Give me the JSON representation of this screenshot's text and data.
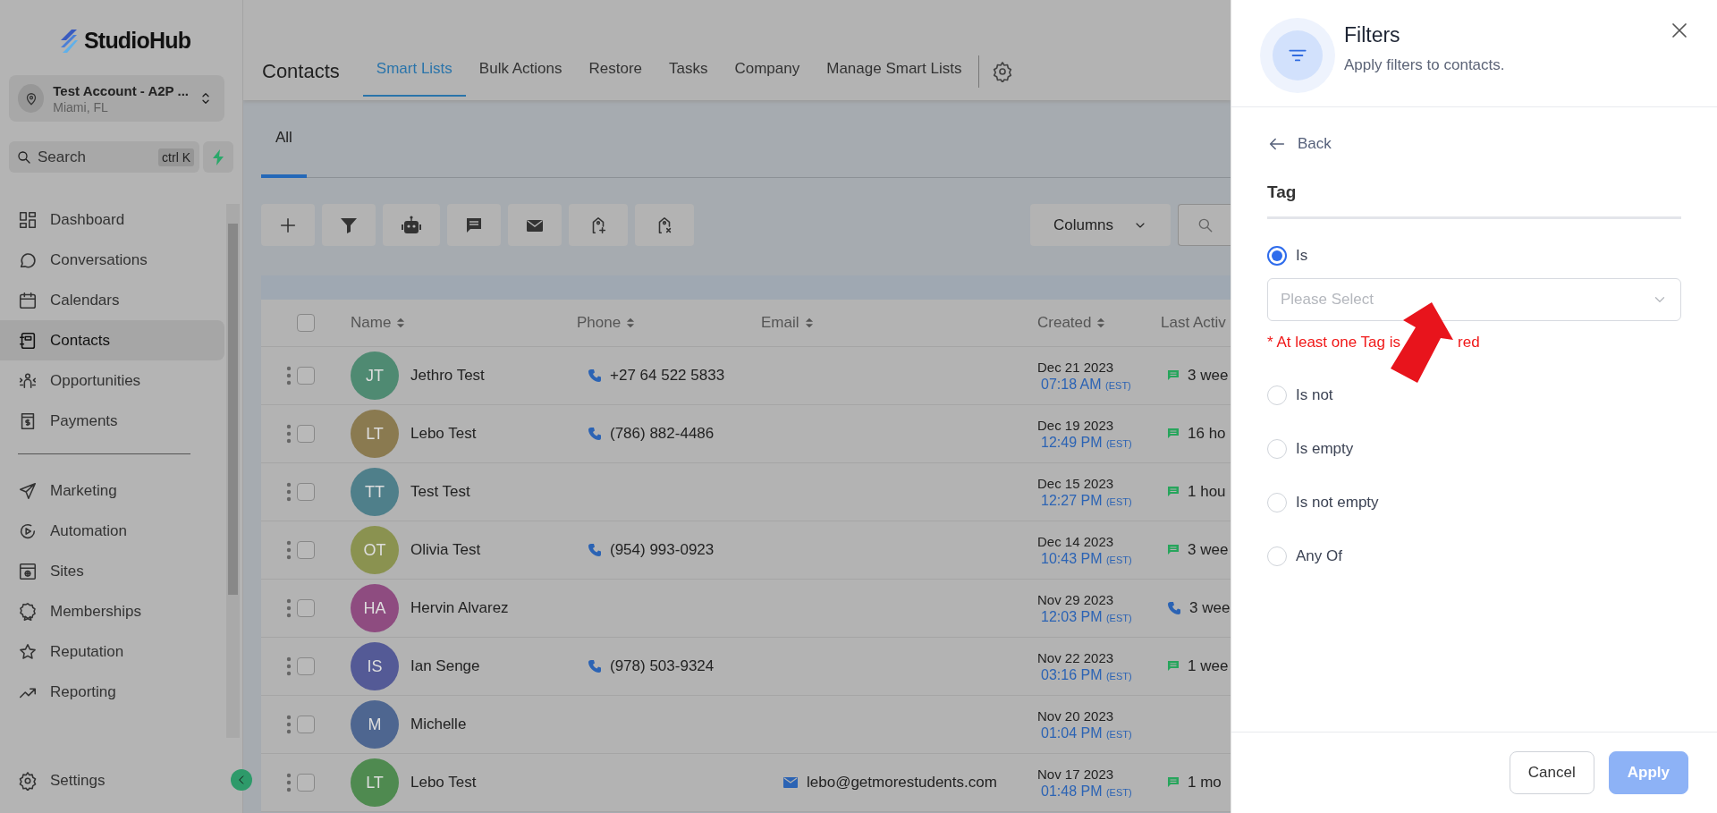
{
  "sidebar": {
    "logo": "StudioHub",
    "account": {
      "name": "Test Account - A2P ...",
      "location": "Miami, FL"
    },
    "search": {
      "placeholder": "Search",
      "shortcut": "ctrl K"
    },
    "main_items": [
      {
        "label": "Dashboard",
        "selected": false
      },
      {
        "label": "Conversations",
        "selected": false
      },
      {
        "label": "Calendars",
        "selected": false
      },
      {
        "label": "Contacts",
        "selected": true
      },
      {
        "label": "Opportunities",
        "selected": false
      },
      {
        "label": "Payments",
        "selected": false
      }
    ],
    "marketing_items": [
      {
        "label": "Marketing",
        "selected": false
      },
      {
        "label": "Automation",
        "selected": false
      },
      {
        "label": "Sites",
        "selected": false
      },
      {
        "label": "Memberships",
        "selected": false
      },
      {
        "label": "Reputation",
        "selected": false
      },
      {
        "label": "Reporting",
        "selected": false
      }
    ],
    "settings": "Settings"
  },
  "header": {
    "title": "Contacts",
    "tabs": [
      {
        "label": "Smart Lists",
        "selected": true
      },
      {
        "label": "Bulk Actions",
        "selected": false
      },
      {
        "label": "Restore",
        "selected": false
      },
      {
        "label": "Tasks",
        "selected": false
      },
      {
        "label": "Company",
        "selected": false
      },
      {
        "label": "Manage Smart Lists",
        "selected": false
      }
    ]
  },
  "list_tabs": [
    {
      "label": "All",
      "selected": true
    }
  ],
  "toolbar": {
    "columns_button": "Columns"
  },
  "table": {
    "select_all_checked": false,
    "columns": [
      "Name",
      "Phone",
      "Email",
      "Created",
      "Last Activ"
    ],
    "rows": [
      {
        "checked": false,
        "initials": "JT",
        "color": "#4f8a72",
        "name": "Jethro Test",
        "phone": "+27 64 522 5833",
        "created_date": "Dec 21 2023",
        "created_time": "07:18 AM",
        "timezone": "(EST)",
        "activity": {
          "kind": "message",
          "text": "3 wee"
        }
      },
      {
        "checked": false,
        "initials": "LT",
        "color": "#8a7a50",
        "name": "Lebo Test",
        "phone": "(786) 882-4486",
        "created_date": "Dec 19 2023",
        "created_time": "12:49 PM",
        "timezone": "(EST)",
        "activity": {
          "kind": "message",
          "text": "16 ho"
        }
      },
      {
        "checked": false,
        "initials": "TT",
        "color": "#4f7f8a",
        "name": "Test Test",
        "created_date": "Dec 15 2023",
        "created_time": "12:27 PM",
        "timezone": "(EST)",
        "activity": {
          "kind": "message",
          "text": "1 hou"
        }
      },
      {
        "checked": false,
        "initials": "OT",
        "color": "#8a9250",
        "name": "Olivia Test",
        "phone": "(954) 993-0923",
        "created_date": "Dec 14 2023",
        "created_time": "10:43 PM",
        "timezone": "(EST)",
        "activity": {
          "kind": "message",
          "text": "3 wee"
        }
      },
      {
        "checked": false,
        "initials": "HA",
        "color": "#8e4c80",
        "name": "Hervin Alvarez",
        "created_date": "Nov 29 2023",
        "created_time": "12:03 PM",
        "timezone": "(EST)",
        "activity": {
          "kind": "call",
          "text": "3 wee"
        }
      },
      {
        "checked": false,
        "initials": "IS",
        "color": "#545a96",
        "name": "Ian Senge",
        "phone": "(978) 503-9324",
        "created_date": "Nov 22 2023",
        "created_time": "03:16 PM",
        "timezone": "(EST)",
        "activity": {
          "kind": "message",
          "text": "1 wee"
        }
      },
      {
        "checked": false,
        "initials": "M",
        "color": "#4e6690",
        "name": "Michelle",
        "created_date": "Nov 20 2023",
        "created_time": "01:04 PM",
        "timezone": "(EST)"
      },
      {
        "checked": false,
        "initials": "LT",
        "color": "#4f8a50",
        "name": "Lebo Test",
        "email": "lebo@getmorestudents.com",
        "created_date": "Nov 17 2023",
        "created_time": "01:48 PM",
        "timezone": "(EST)",
        "activity": {
          "kind": "message",
          "text": "1 mo"
        }
      }
    ]
  },
  "filter_panel": {
    "title": "Filters",
    "subtitle": "Apply filters to contacts.",
    "back": "Back",
    "field": "Tag",
    "options": [
      {
        "label": "Is",
        "selected": true
      },
      {
        "label": "Is not",
        "selected": false
      },
      {
        "label": "Is empty",
        "selected": false
      },
      {
        "label": "Is not empty",
        "selected": false
      },
      {
        "label": "Any Of",
        "selected": false
      }
    ],
    "select": {
      "placeholder": "Please Select"
    },
    "error_parts": [
      "* At least one Tag is",
      "red"
    ],
    "buttons": {
      "cancel": "Cancel",
      "apply": "Apply"
    },
    "apply_disabled": true
  }
}
